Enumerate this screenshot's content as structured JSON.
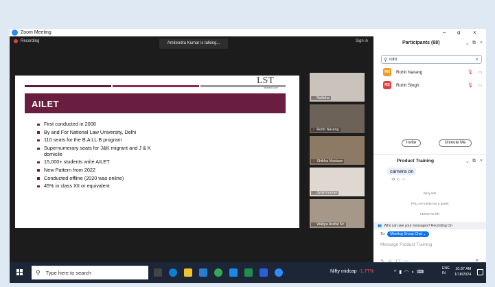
{
  "window": {
    "title": "Zoom Meeting",
    "minimize": "–",
    "restore": "ɑ",
    "close": "×"
  },
  "meeting": {
    "recording_label": "Recording",
    "talking_indicator": "Amitendra Kumar is talking...",
    "sign_in": "Sign in"
  },
  "slide": {
    "title": "AILET",
    "logo_text": "LST",
    "logo_sub": "lawsikho.com",
    "bullets": [
      "First conducted in 2008",
      "By and For National Law University, Delhi",
      "110 seats for the B.A LL.B program",
      "Supernumerary seats for J&K migrant and J & K domicile",
      "15,000+ students write AILET",
      "New Pattern from 2022",
      "Conducted offline (2020 was online)",
      "45% in class XII or equivalent"
    ],
    "colors": {
      "header": "#6a1e3f",
      "bar1": "#5c1d3c",
      "bar2": "#8a2a55",
      "bar3": "#999999"
    }
  },
  "video_tiles": [
    {
      "name": "Nafisha",
      "color": "#c9c3bb"
    },
    {
      "name": "Rohit Narang",
      "color": "#6d6257"
    },
    {
      "name": "Shikha Madaan",
      "color": "#8c7a64"
    },
    {
      "name": "Jyoti Kumari",
      "color": "#ded8d0"
    },
    {
      "name": "Waliya Arafat Nc",
      "color": "#a59888"
    }
  ],
  "participants": {
    "title": "Participants (98)",
    "search_value": "rohi",
    "list": [
      {
        "initials": "RN",
        "name": "Rohit Narang",
        "avatar_color": "#f29b1e"
      },
      {
        "initials": "RS",
        "name": "Rohit Singh",
        "avatar_color": "#e04040"
      }
    ],
    "invite_label": "Invite",
    "unmute_label": "Unmute Me"
  },
  "chat": {
    "title": "Product Training",
    "last_message": "camera on",
    "system_messages": [
      "Mizy left",
      "PALLAV joined as a guest",
      "LENOVO left"
    ],
    "privacy_notice": "Who can see your messages? Recording On",
    "to_label": "To:",
    "recipient": "Meeting Group Chat ⌄",
    "input_placeholder": "Message Product Training"
  },
  "taskbar": {
    "search_placeholder": "Type here to search",
    "ticker_name": "Nifty midcap",
    "ticker_change": "-1.77%",
    "lang_line1": "ENG",
    "lang_line2": "IN",
    "time": "10:37 AM",
    "date": "1/18/2024"
  }
}
